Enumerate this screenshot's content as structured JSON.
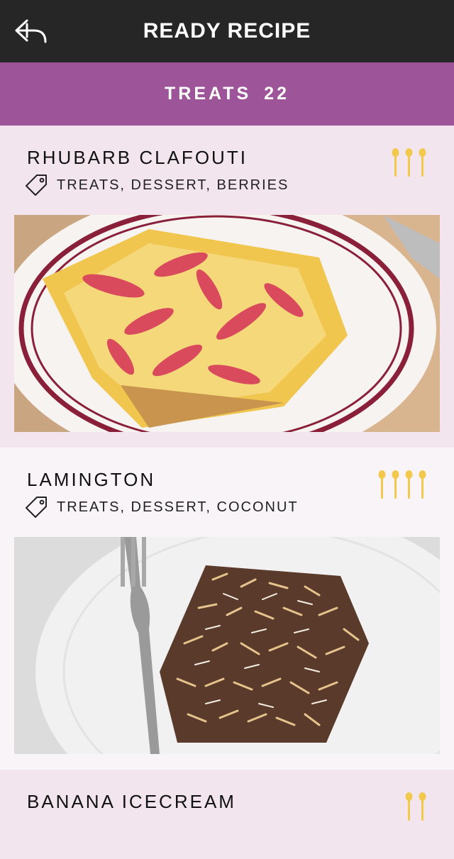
{
  "header": {
    "title": "READY RECIPE"
  },
  "category": {
    "name": "TREATS",
    "count": "22"
  },
  "colors": {
    "spoon": "#f2c94c",
    "accent": "#9d5499",
    "topbar": "#262626"
  },
  "recipes": [
    {
      "name": "RHUBARB CLAFOUTI",
      "tags": "TREATS, DESSERT, BERRIES",
      "difficulty": 3
    },
    {
      "name": "LAMINGTON",
      "tags": "TREATS, DESSERT, COCONUT",
      "difficulty": 4
    },
    {
      "name": "BANANA ICECREAM",
      "tags": "",
      "difficulty": 2
    }
  ]
}
